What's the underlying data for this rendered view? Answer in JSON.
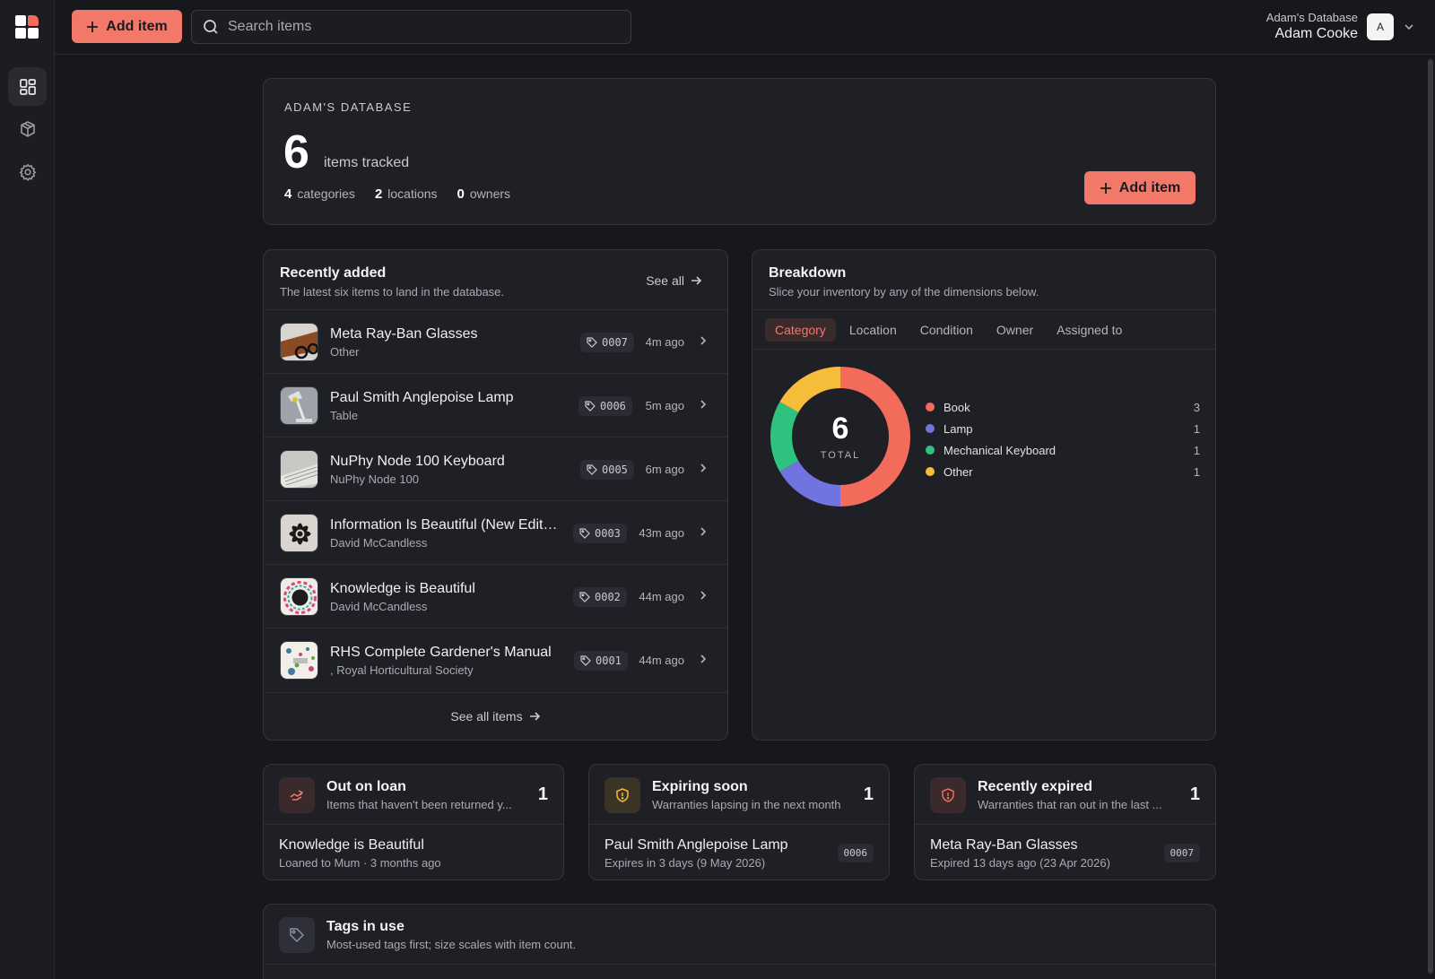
{
  "topbar": {
    "add_label": "Add item",
    "search_placeholder": "Search items",
    "user_db": "Adam's Database",
    "user_name": "Adam Cooke",
    "avatar_letter": "A"
  },
  "sidebar": {
    "items": [
      {
        "icon": "dashboard-icon",
        "active": true
      },
      {
        "icon": "box-icon",
        "active": false
      },
      {
        "icon": "gear-icon",
        "active": false
      }
    ]
  },
  "hero": {
    "eyebrow": "ADAM'S DATABASE",
    "count": "6",
    "count_label": "items tracked",
    "stats": [
      {
        "value": "4",
        "label": "categories"
      },
      {
        "value": "2",
        "label": "locations"
      },
      {
        "value": "0",
        "label": "owners"
      }
    ],
    "add_label": "Add item"
  },
  "recent": {
    "title": "Recently added",
    "subtitle": "The latest six items to land in the database.",
    "see_all": "See all",
    "see_all_items": "See all items",
    "items": [
      {
        "title": "Meta Ray-Ban Glasses",
        "sub": "Other",
        "tag": "0007",
        "ago": "4m ago"
      },
      {
        "title": "Paul Smith Anglepoise Lamp",
        "sub": "Table",
        "tag": "0006",
        "ago": "5m ago"
      },
      {
        "title": "NuPhy Node 100 Keyboard",
        "sub": "NuPhy Node 100",
        "tag": "0005",
        "ago": "6m ago"
      },
      {
        "title": "Information Is Beautiful (New Editi...",
        "sub": "David McCandless",
        "tag": "0003",
        "ago": "43m ago"
      },
      {
        "title": "Knowledge is Beautiful",
        "sub": "David McCandless",
        "tag": "0002",
        "ago": "44m ago"
      },
      {
        "title": "RHS Complete Gardener's Manual",
        "sub": ", Royal Horticultural Society",
        "tag": "0001",
        "ago": "44m ago"
      }
    ]
  },
  "breakdown": {
    "title": "Breakdown",
    "subtitle": "Slice your inventory by any of the dimensions below.",
    "tabs": [
      "Category",
      "Location",
      "Condition",
      "Owner",
      "Assigned to"
    ],
    "active_tab": "Category",
    "total": "6",
    "total_label": "TOTAL"
  },
  "chart_data": {
    "type": "pie",
    "categories": [
      "Book",
      "Lamp",
      "Mechanical Keyboard",
      "Other"
    ],
    "values": [
      3,
      1,
      1,
      1
    ],
    "colors": [
      "#f26b5b",
      "#7173e0",
      "#2fc27e",
      "#f5bd3a"
    ],
    "title": "",
    "legend_position": "right"
  },
  "loan": {
    "title": "Out on loan",
    "subtitle": "Items that haven't been returned y...",
    "count": "1",
    "item": "Knowledge is Beautiful",
    "meta": "Loaned to Mum · 3 months ago"
  },
  "expiring": {
    "title": "Expiring soon",
    "subtitle": "Warranties lapsing in the next month",
    "count": "1",
    "item": "Paul Smith Anglepoise Lamp",
    "meta": "Expires in 3 days (9 May 2026)",
    "tag": "0006"
  },
  "expired": {
    "title": "Recently expired",
    "subtitle": "Warranties that ran out in the last ...",
    "count": "1",
    "item": "Meta Ray-Ban Glasses",
    "meta": "Expired 13 days ago (23 Apr 2026)",
    "tag": "0007"
  },
  "tags_card": {
    "title": "Tags in use",
    "subtitle": "Most-used tags first; size scales with item count."
  },
  "colors": {
    "accent": "#f2796a",
    "background": "#17181c",
    "card": "#1f2025"
  }
}
